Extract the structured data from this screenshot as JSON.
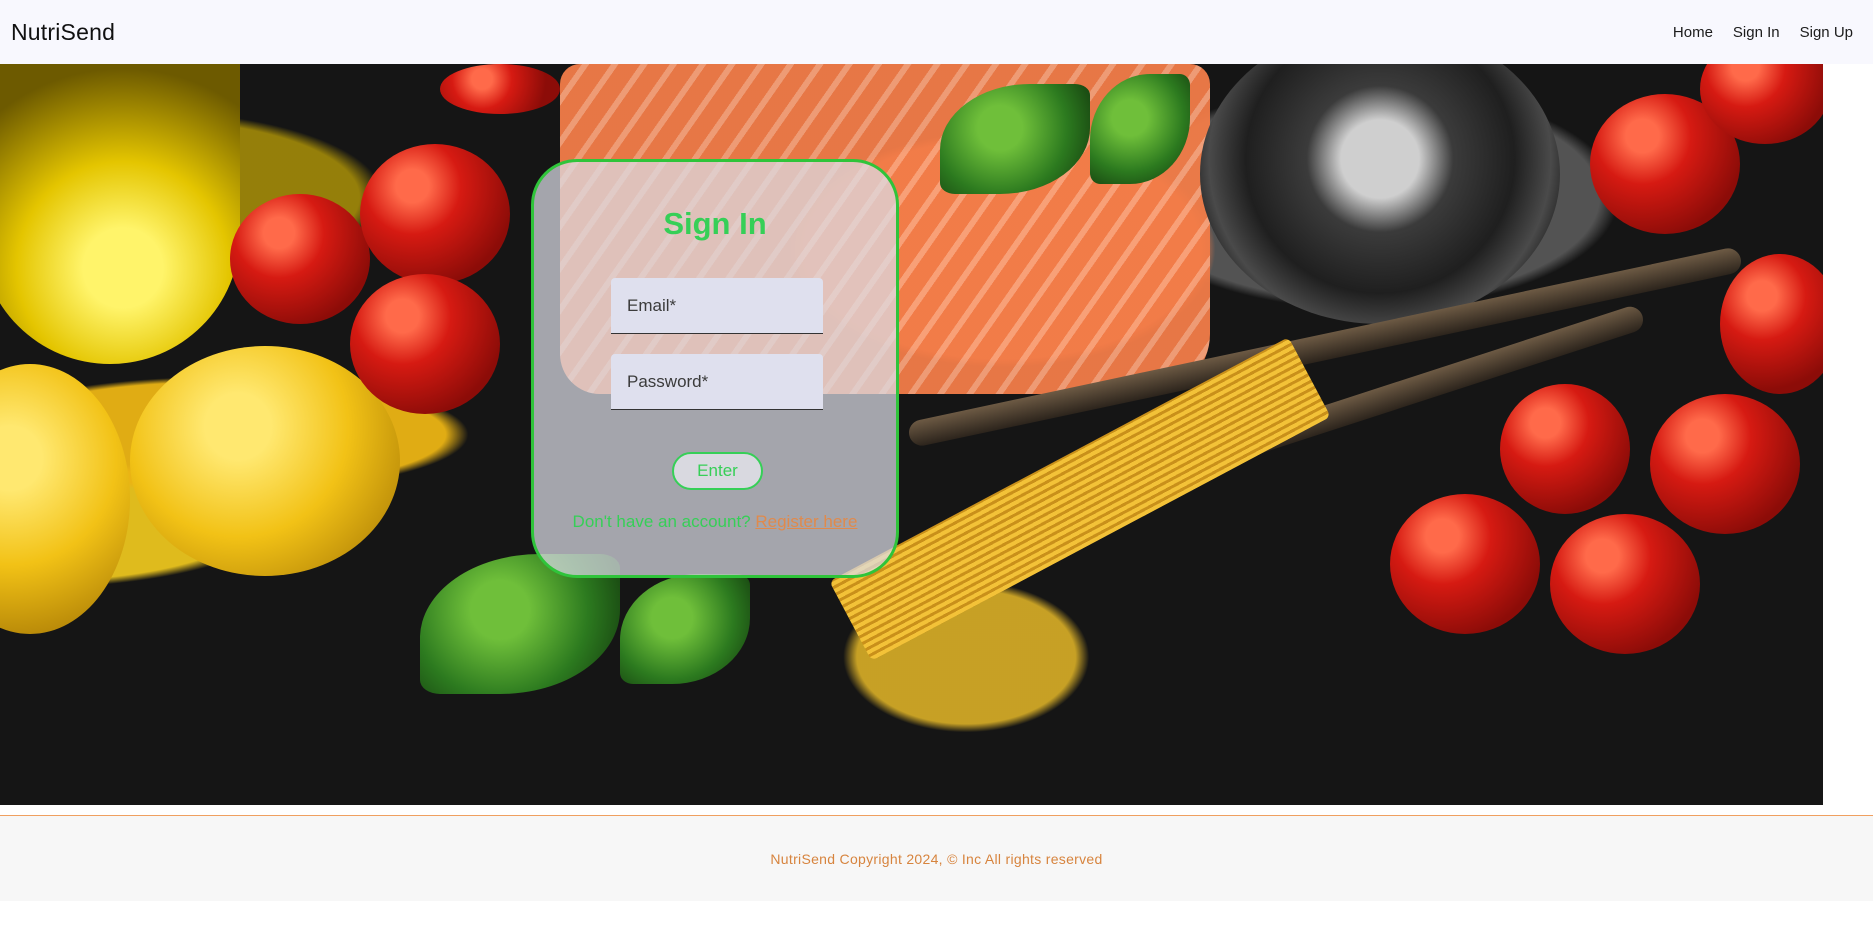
{
  "nav": {
    "brand": "NutriSend",
    "links": [
      "Home",
      "Sign In",
      "Sign Up"
    ]
  },
  "signin": {
    "title": "Sign In",
    "email_placeholder": "Email*",
    "password_placeholder": "Password*",
    "enter_label": "Enter",
    "register_prompt": "Don't have an account? ",
    "register_link": "Register here"
  },
  "footer": {
    "text": "NutriSend Copyright 2024, © Inc All rights reserved"
  },
  "colors": {
    "accent_green": "#36cf57",
    "link_orange": "#e08a4c",
    "footer_text": "#d7843e"
  }
}
